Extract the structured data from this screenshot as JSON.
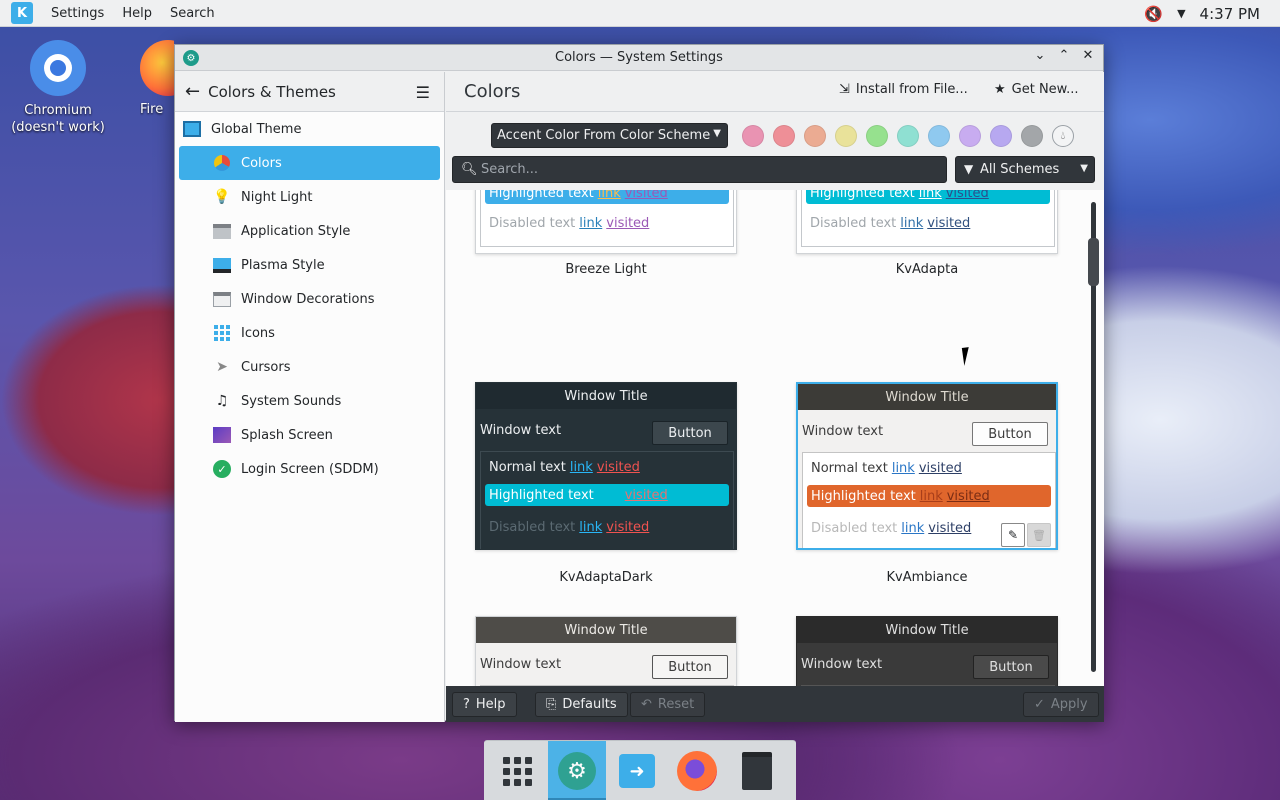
{
  "top_panel": {
    "menus": [
      "Settings",
      "Help",
      "Search"
    ],
    "clock": "4:37 PM",
    "icons": [
      "kde-logo",
      "volume-muted-icon",
      "chevron-down-icon"
    ]
  },
  "desktop": {
    "icons": [
      {
        "label": "Chromium (doesn't work)",
        "icon": "chromium-icon"
      },
      {
        "label": "Fire",
        "icon": "firefox-icon"
      }
    ]
  },
  "window": {
    "title": "Colors — System Settings"
  },
  "sidebar": {
    "header": "Colors & Themes",
    "category": "Global Theme",
    "items": [
      {
        "label": "Colors",
        "icon": "colors-icon",
        "active": true
      },
      {
        "label": "Night Light",
        "icon": "lightbulb-icon"
      },
      {
        "label": "Application Style",
        "icon": "app-style-icon"
      },
      {
        "label": "Plasma Style",
        "icon": "plasma-style-icon"
      },
      {
        "label": "Window Decorations",
        "icon": "window-decorations-icon"
      },
      {
        "label": "Icons",
        "icon": "icons-icon"
      },
      {
        "label": "Cursors",
        "icon": "cursor-icon"
      },
      {
        "label": "System Sounds",
        "icon": "music-note-icon"
      },
      {
        "label": "Splash Screen",
        "icon": "splash-icon"
      },
      {
        "label": "Login Screen (SDDM)",
        "icon": "check-circle-icon"
      }
    ]
  },
  "content": {
    "title": "Colors",
    "install_label": "Install from File...",
    "get_new_label": "Get New...",
    "accent_select": "Accent Color From Color Scheme",
    "swatches": [
      "#e993b2",
      "#ee8f97",
      "#ebab92",
      "#e9e29a",
      "#96e18e",
      "#8fe0d2",
      "#8fc9ef",
      "#c8acf0",
      "#b7a8f0",
      "#a3a6a9",
      "#f3f4f5"
    ],
    "search_placeholder": "Search...",
    "filter_label": "All Schemes"
  },
  "schemes": {
    "common": {
      "window_title": "Window Title",
      "window_text": "Window text",
      "button": "Button",
      "normal": "Normal text",
      "highlighted": "Highlighted text",
      "disabled": "Disabled text",
      "link": "link",
      "visited": "visited"
    },
    "names": [
      "Breeze Light",
      "KvAdapta",
      "KvAdaptaDark",
      "KvAmbiance"
    ]
  },
  "footer": {
    "help": "Help",
    "defaults": "Defaults",
    "reset": "Reset",
    "apply": "Apply"
  },
  "dock": {
    "items": [
      "app-launcher-icon",
      "system-settings-icon",
      "discover-icon",
      "firefox-icon",
      "trash-icon"
    ]
  }
}
